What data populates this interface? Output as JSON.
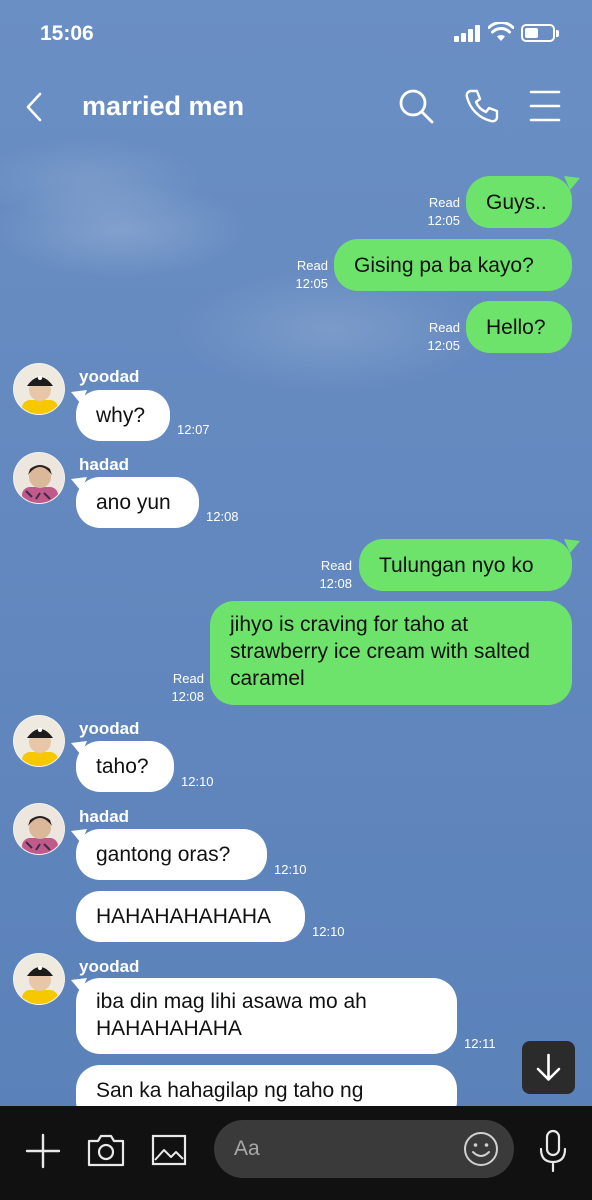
{
  "status_bar": {
    "time": "15:06",
    "battery_level": 0.5
  },
  "header": {
    "title": "married men"
  },
  "icons": {
    "back": "back-chevron-icon",
    "search": "search-icon",
    "call": "phone-icon",
    "menu": "menu-icon",
    "scroll_down": "arrow-down-icon",
    "add": "plus-icon",
    "camera": "camera-icon",
    "gallery": "image-icon",
    "emoji": "emoji-icon",
    "mic": "microphone-icon"
  },
  "colors": {
    "sent_bubble": "#6ee36c",
    "received_bubble": "#ffffff",
    "background": "#5f86bd",
    "bottom_bar": "#111111"
  },
  "messages": [
    {
      "type": "sent",
      "text": "Guys..",
      "read": "Read",
      "time": "12:05"
    },
    {
      "type": "sent",
      "text": "Gising pa ba kayo?",
      "read": "Read",
      "time": "12:05"
    },
    {
      "type": "sent",
      "text": "Hello?",
      "read": "Read",
      "time": "12:05"
    },
    {
      "type": "received",
      "sender": "yoodad",
      "text": "why?",
      "time": "12:07"
    },
    {
      "type": "received",
      "sender": "hadad",
      "text": "ano yun",
      "time": "12:08"
    },
    {
      "type": "sent",
      "text": "Tulungan nyo ko",
      "read": "Read",
      "time": "12:08"
    },
    {
      "type": "sent",
      "text": "jihyo is craving for taho at strawberry ice cream with salted caramel",
      "read": "Read",
      "time": "12:08"
    },
    {
      "type": "received",
      "sender": "yoodad",
      "text": "taho?",
      "time": "12:10"
    },
    {
      "type": "received",
      "sender": "hadad",
      "text": "gantong oras?",
      "time": "12:10"
    },
    {
      "type": "received",
      "sender": "",
      "text": "HAHAHAHAHAHA",
      "time": "12:10"
    },
    {
      "type": "received",
      "sender": "yoodad",
      "text": "iba din mag lihi asawa mo ah HAHAHAHAHA",
      "time": "12:11"
    },
    {
      "type": "received",
      "sender": "",
      "text": "San ka hahagilap ng taho ng",
      "time": ""
    }
  ],
  "composer": {
    "placeholder": "Aa"
  }
}
